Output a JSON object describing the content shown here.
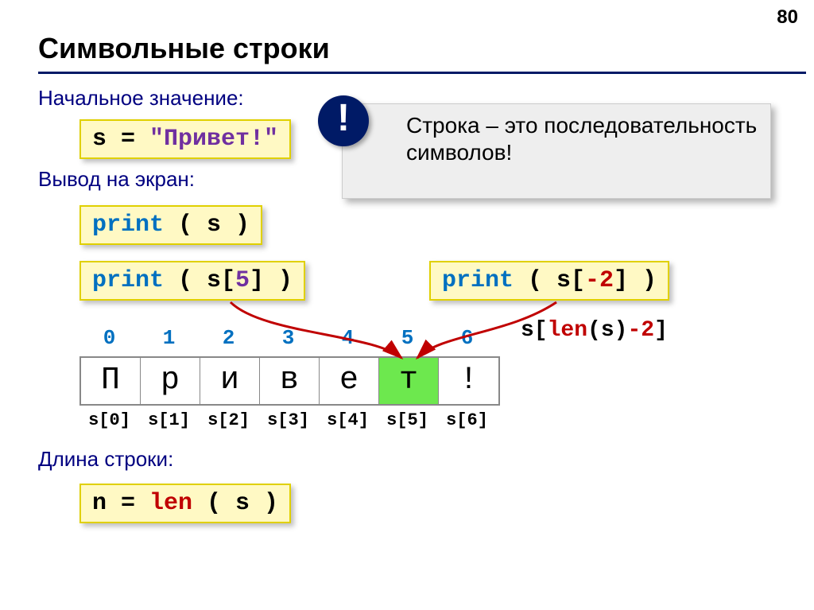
{
  "page_num": "80",
  "title": "Символьные строки",
  "labels": {
    "initial": "Начальное значение:",
    "output": "Вывод на экран:",
    "length": "Длина строки:"
  },
  "callout": {
    "bang": "!",
    "text": "Строка – это последовательность символов!"
  },
  "code": {
    "assign_lhs": "s = ",
    "assign_rhs": "\"Привет!\"",
    "print_kw": "print",
    "print1_arg": " ( s )",
    "print2_open": " ( s[",
    "print2_idx": "5",
    "print2_close": "] )",
    "print3_open": " ( s[",
    "print3_idx": "-2",
    "print3_close": "] )",
    "len_lhs": "n = ",
    "len_kw": "len",
    "len_arg": " ( s )",
    "len_expr_a": "s[",
    "len_expr_b": "len",
    "len_expr_c": "(s)",
    "len_expr_d": "-2",
    "len_expr_e": "]"
  },
  "array": {
    "indices": [
      "0",
      "1",
      "2",
      "3",
      "4",
      "5",
      "6"
    ],
    "chars": [
      "П",
      "р",
      "и",
      "в",
      "е",
      "т",
      "!"
    ],
    "subs": [
      "s[0]",
      "s[1]",
      "s[2]",
      "s[3]",
      "s[4]",
      "s[5]",
      "s[6]"
    ],
    "highlight": 5
  }
}
